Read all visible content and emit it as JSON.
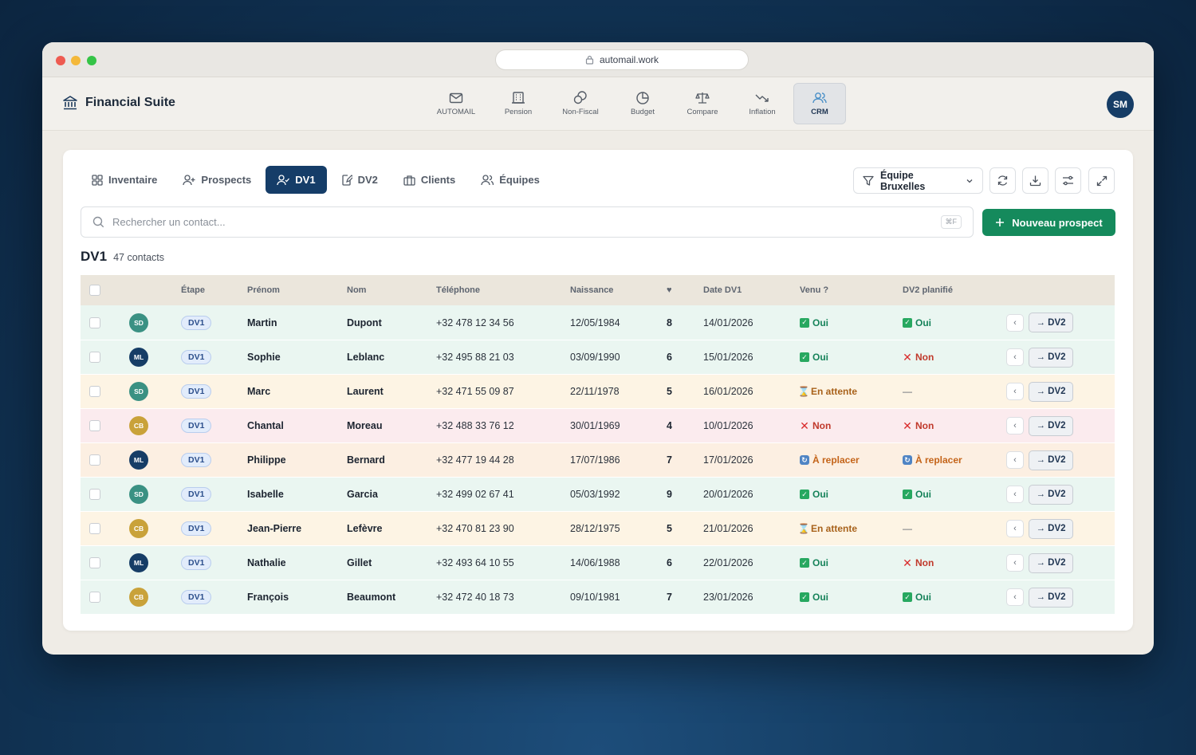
{
  "browser": {
    "url": "automail.work"
  },
  "app": {
    "brand": "Financial Suite",
    "nav": [
      {
        "label": "AUTOMAIL",
        "icon": "mail-icon"
      },
      {
        "label": "Pension",
        "icon": "building-icon"
      },
      {
        "label": "Non-Fiscal",
        "icon": "coins-icon"
      },
      {
        "label": "Budget",
        "icon": "pie-chart-icon"
      },
      {
        "label": "Compare",
        "icon": "scale-icon"
      },
      {
        "label": "Inflation",
        "icon": "trending-down-icon"
      },
      {
        "label": "CRM",
        "icon": "users-icon",
        "active": true
      }
    ],
    "user_initials": "SM"
  },
  "subtabs": [
    {
      "label": "Inventaire",
      "icon": "grid-icon"
    },
    {
      "label": "Prospects",
      "icon": "user-plus-icon"
    },
    {
      "label": "DV1",
      "icon": "user-check-icon",
      "active": true
    },
    {
      "label": "DV2",
      "icon": "edit-doc-icon"
    },
    {
      "label": "Clients",
      "icon": "briefcase-icon"
    },
    {
      "label": "Équipes",
      "icon": "team-icon"
    }
  ],
  "toolbar": {
    "team_filter": "Équipe Bruxelles",
    "search_placeholder": "Rechercher un contact...",
    "search_shortcut": "⌘F",
    "new_button": "Nouveau prospect"
  },
  "list": {
    "title": "DV1",
    "count": "47 contacts"
  },
  "columns": [
    "Étape",
    "Prénom",
    "Nom",
    "Téléphone",
    "Naissance",
    "♥",
    "Date DV1",
    "Venu ?",
    "DV2 planifié"
  ],
  "colors": {
    "accent": "#153d68",
    "primary_action": "#158a5c",
    "avatar_SD": "#3a9183",
    "avatar_ML": "#163d66",
    "avatar_CB": "#c9a23a"
  },
  "rows": [
    {
      "initials": "SD",
      "stage": "DV1",
      "first": "Martin",
      "last": "Dupont",
      "phone": "+32 478 12 34 56",
      "birth": "12/05/1984",
      "score": "8",
      "date": "14/01/2026",
      "venu": "Oui",
      "dv2": "Oui",
      "action": "→ DV2",
      "tone": "green"
    },
    {
      "initials": "ML",
      "stage": "DV1",
      "first": "Sophie",
      "last": "Leblanc",
      "phone": "+32 495 88 21 03",
      "birth": "03/09/1990",
      "score": "6",
      "date": "15/01/2026",
      "venu": "Oui",
      "dv2": "Non",
      "action": "→ DV2",
      "tone": "green"
    },
    {
      "initials": "SD",
      "stage": "DV1",
      "first": "Marc",
      "last": "Laurent",
      "phone": "+32 471 55 09 87",
      "birth": "22/11/1978",
      "score": "5",
      "date": "16/01/2026",
      "venu": "En attente",
      "dv2": "—",
      "action": "→ DV2",
      "tone": "yellow"
    },
    {
      "initials": "CB",
      "stage": "DV1",
      "first": "Chantal",
      "last": "Moreau",
      "phone": "+32 488 33 76 12",
      "birth": "30/01/1969",
      "score": "4",
      "date": "10/01/2026",
      "venu": "Non",
      "dv2": "Non",
      "action": "→ DV2",
      "tone": "pink"
    },
    {
      "initials": "ML",
      "stage": "DV1",
      "first": "Philippe",
      "last": "Bernard",
      "phone": "+32 477 19 44 28",
      "birth": "17/07/1986",
      "score": "7",
      "date": "17/01/2026",
      "venu": "À replacer",
      "dv2": "À replacer",
      "action": "→ DV2",
      "tone": "orange"
    },
    {
      "initials": "SD",
      "stage": "DV1",
      "first": "Isabelle",
      "last": "Garcia",
      "phone": "+32 499 02 67 41",
      "birth": "05/03/1992",
      "score": "9",
      "date": "20/01/2026",
      "venu": "Oui",
      "dv2": "Oui",
      "action": "→ DV2",
      "tone": "green"
    },
    {
      "initials": "CB",
      "stage": "DV1",
      "first": "Jean-Pierre",
      "last": "Lefèvre",
      "phone": "+32 470 81 23 90",
      "birth": "28/12/1975",
      "score": "5",
      "date": "21/01/2026",
      "venu": "En attente",
      "dv2": "—",
      "action": "→ DV2",
      "tone": "yellow"
    },
    {
      "initials": "ML",
      "stage": "DV1",
      "first": "Nathalie",
      "last": "Gillet",
      "phone": "+32 493 64 10 55",
      "birth": "14/06/1988",
      "score": "6",
      "date": "22/01/2026",
      "venu": "Oui",
      "dv2": "Non",
      "action": "→ DV2",
      "tone": "green"
    },
    {
      "initials": "CB",
      "stage": "DV1",
      "first": "François",
      "last": "Beaumont",
      "phone": "+32 472 40 18 73",
      "birth": "09/10/1981",
      "score": "7",
      "date": "23/01/2026",
      "venu": "Oui",
      "dv2": "Oui",
      "action": "→ DV2",
      "tone": "green"
    }
  ]
}
